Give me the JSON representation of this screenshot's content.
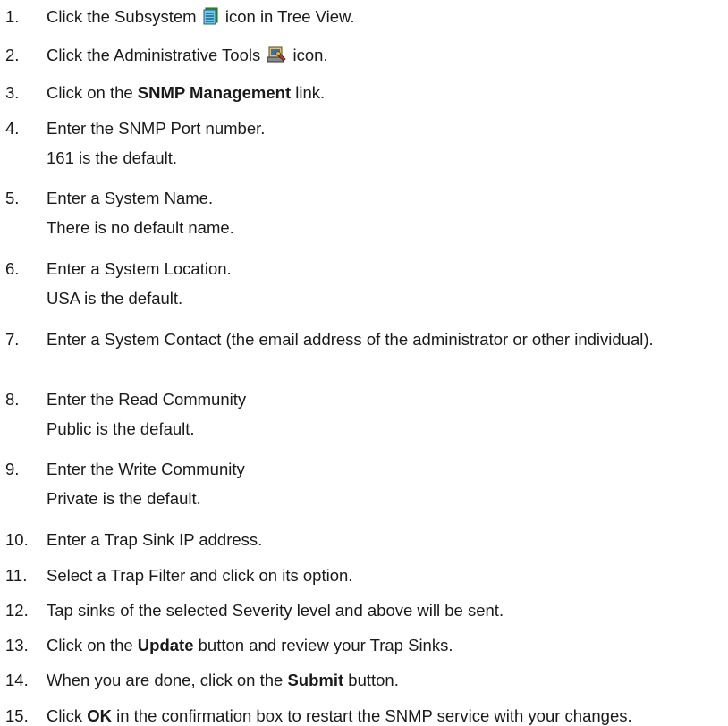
{
  "steps": [
    {
      "num": "1.",
      "before": "Click the Subsystem ",
      "icon": "subsystem-icon",
      "after": " icon in Tree View."
    },
    {
      "num": "2.",
      "before": "Click the Administrative Tools ",
      "icon": "administrative-tools-icon",
      "after": " icon."
    },
    {
      "num": "3.",
      "before": "Click on the ",
      "bold": "SNMP Management",
      "after": " link."
    },
    {
      "num": "4.",
      "text": "Enter the SNMP Port number.",
      "note": "161 is the default."
    },
    {
      "num": "5.",
      "text": "Enter a System Name.",
      "note": "There is no default name."
    },
    {
      "num": "6.",
      "text": "Enter a System Location.",
      "note": "USA is the default."
    },
    {
      "num": "7.",
      "text": "Enter a System Contact (the email address of the administrator or other individual)."
    },
    {
      "num": "8.",
      "text": "Enter the Read Community",
      "note": "Public is the default."
    },
    {
      "num": "9.",
      "text": "Enter the Write Community",
      "note": "Private is the default."
    },
    {
      "num": "10.",
      "text": "Enter a Trap Sink IP address."
    },
    {
      "num": "11.",
      "text": "Select a Trap Filter and click on its option."
    },
    {
      "num": "12.",
      "text": "Tap sinks of the selected Severity level and above will be sent."
    },
    {
      "num": "13.",
      "before": "Click on the ",
      "bold": "Update",
      "after": " button and review your Trap Sinks."
    },
    {
      "num": "14.",
      "before": "When you are done, click on the ",
      "bold": "Submit",
      "after": " button."
    },
    {
      "num": "15.",
      "before": "Click ",
      "bold": "OK",
      "after": " in the confirmation box to restart the SNMP service with your changes."
    }
  ]
}
